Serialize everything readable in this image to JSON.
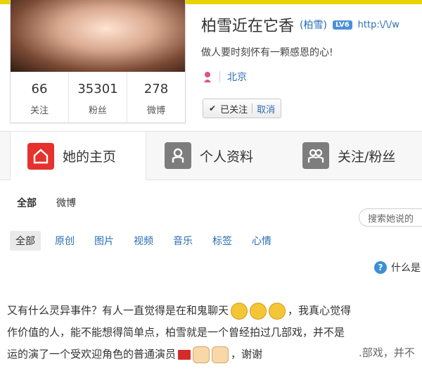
{
  "profile": {
    "name": "柏雪近在它香",
    "name_paren": "(柏雪)",
    "level_badge": "LV6",
    "url_fragment": "http:\\/\\/w",
    "bio": "做人要时刻怀有一颗感恩的心!",
    "location": "北京",
    "stats": [
      {
        "value": "66",
        "label": "关注"
      },
      {
        "value": "35301",
        "label": "粉丝"
      },
      {
        "value": "278",
        "label": "微博"
      }
    ],
    "follow_status": "已关注",
    "cancel_label": "取消"
  },
  "tabs": [
    {
      "label": "她的主页",
      "icon": "home-icon",
      "active": true
    },
    {
      "label": "个人资料",
      "icon": "person-icon",
      "active": false
    },
    {
      "label": "关注/粉丝",
      "icon": "people-icon",
      "active": false
    }
  ],
  "subnav": [
    "全部",
    "微博"
  ],
  "search_placeholder": "搜索她说的",
  "filters": [
    "全部",
    "原创",
    "图片",
    "视频",
    "音乐",
    "标签",
    "心情"
  ],
  "help_text": "什么是",
  "post_lines": [
    "又有什么灵异事件？有人一直觉得是在和鬼聊天",
    "，我真心觉得",
    "作价值的人，能不能想得简单点，柏雪就是一个曾经拍过几部戏，并不是",
    "运的演了一个受欢迎角色的普通演员",
    "，谢谢"
  ],
  "overlay_text": ".部戏，并不",
  "colors": {
    "accent_red": "#e5322d",
    "link_blue": "#2a6db3",
    "top_strip": "#e9d300"
  }
}
